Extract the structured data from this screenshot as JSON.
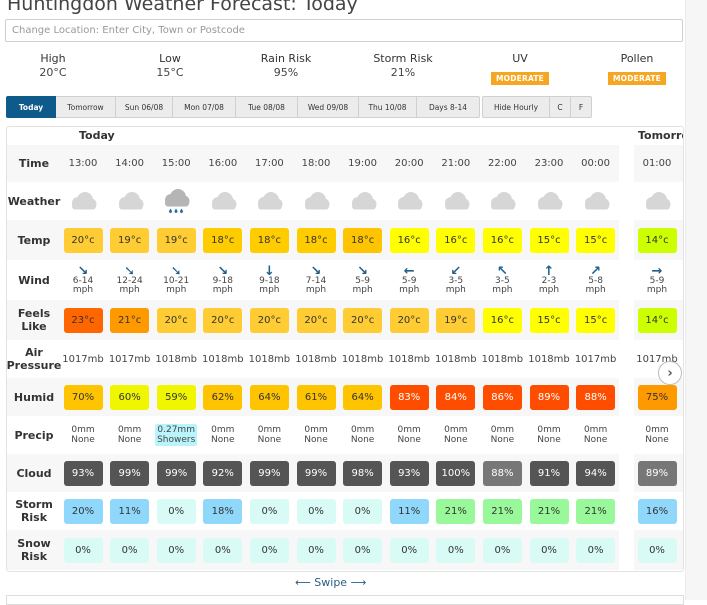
{
  "page": {
    "title": "Huntingdon Weather Forecast: Today",
    "location_placeholder": "Change Location: Enter City, Town or Postcode"
  },
  "summary": {
    "high": {
      "label": "High",
      "value": "20°C"
    },
    "low": {
      "label": "Low",
      "value": "15°C"
    },
    "rain_risk": {
      "label": "Rain Risk",
      "value": "95%"
    },
    "storm_risk": {
      "label": "Storm Risk",
      "value": "21%"
    },
    "uv": {
      "label": "UV",
      "badge": "MODERATE"
    },
    "pollen": {
      "label": "Pollen",
      "badge": "MODERATE"
    },
    "badge_color": "#f5a623"
  },
  "tabs": [
    {
      "label": "Today",
      "active": true
    },
    {
      "label": "Tomorrow",
      "active": false
    },
    {
      "label": "Sun 06/08",
      "active": false
    },
    {
      "label": "Mon 07/08",
      "active": false
    },
    {
      "label": "Tue 08/08",
      "active": false
    },
    {
      "label": "Wed 09/08",
      "active": false
    },
    {
      "label": "Thu 10/08",
      "active": false
    },
    {
      "label": "Days 8-14",
      "active": false
    }
  ],
  "options": [
    {
      "label": "Hide Hourly"
    },
    {
      "label": "C"
    },
    {
      "label": "F"
    }
  ],
  "table": {
    "day_labels": {
      "today": "Today",
      "tomorrow": "Tomorro"
    },
    "row_labels": {
      "time": "Time",
      "weather": "Weather",
      "temp": "Temp",
      "wind": "Wind",
      "feels_like": "Feels Like",
      "pressure": "Air Pressure",
      "humid": "Humid",
      "precip": "Precip",
      "cloud": "Cloud",
      "storm": "Storm Risk",
      "snow": "Snow Risk"
    },
    "hours": [
      {
        "time": "13:00",
        "weather": "cloud-icon",
        "temp": "20°c",
        "temp_color": "#ffcc33",
        "wind_dir": "↘",
        "wind": "6-14",
        "wind_unit": "mph",
        "feels": "23°c",
        "feels_color": "#ff6600",
        "pressure": "1017mb",
        "humid": "70%",
        "humid_color": "#ffc400",
        "precip_amount": "0mm",
        "precip_type": "None",
        "precip_highlight": false,
        "cloud": "93%",
        "cloud_color": "#555555",
        "storm": "20%",
        "storm_color": "#8fd8fb",
        "snow": "0%"
      },
      {
        "time": "14:00",
        "weather": "cloud-icon",
        "temp": "19°c",
        "temp_color": "#ffcc33",
        "wind_dir": "➘",
        "wind": "12-24",
        "wind_unit": "mph",
        "feels": "21°c",
        "feels_color": "#ff9900",
        "pressure": "1017mb",
        "humid": "60%",
        "humid_color": "#f0f500",
        "precip_amount": "0mm",
        "precip_type": "None",
        "precip_highlight": false,
        "cloud": "99%",
        "cloud_color": "#555555",
        "storm": "11%",
        "storm_color": "#8fd8fb",
        "snow": "0%"
      },
      {
        "time": "15:00",
        "weather": "rain-cloud-icon",
        "temp": "19°c",
        "temp_color": "#ffcc33",
        "wind_dir": "➘",
        "wind": "10-21",
        "wind_unit": "mph",
        "feels": "20°c",
        "feels_color": "#ffcc33",
        "pressure": "1018mb",
        "humid": "59%",
        "humid_color": "#f0f500",
        "precip_amount": "0.27mm",
        "precip_type": "Showers",
        "precip_highlight": true,
        "cloud": "99%",
        "cloud_color": "#555555",
        "storm": "0%",
        "storm_color": "#d9fbf6",
        "snow": "0%"
      },
      {
        "time": "16:00",
        "weather": "cloud-icon",
        "temp": "18°c",
        "temp_color": "#ffcc00",
        "wind_dir": "↘",
        "wind": "9-18",
        "wind_unit": "mph",
        "feels": "20°c",
        "feels_color": "#ffcc33",
        "pressure": "1018mb",
        "humid": "62%",
        "humid_color": "#ffc400",
        "precip_amount": "0mm",
        "precip_type": "None",
        "precip_highlight": false,
        "cloud": "92%",
        "cloud_color": "#555555",
        "storm": "18%",
        "storm_color": "#8fd8fb",
        "snow": "0%"
      },
      {
        "time": "17:00",
        "weather": "cloud-icon",
        "temp": "18°c",
        "temp_color": "#ffcc00",
        "wind_dir": "↓",
        "wind": "9-18",
        "wind_unit": "mph",
        "feels": "20°c",
        "feels_color": "#ffcc33",
        "pressure": "1018mb",
        "humid": "64%",
        "humid_color": "#ffc400",
        "precip_amount": "0mm",
        "precip_type": "None",
        "precip_highlight": false,
        "cloud": "99%",
        "cloud_color": "#555555",
        "storm": "0%",
        "storm_color": "#d9fbf6",
        "snow": "0%"
      },
      {
        "time": "18:00",
        "weather": "cloud-icon",
        "temp": "18°c",
        "temp_color": "#ffcc00",
        "wind_dir": "↘",
        "wind": "7-14",
        "wind_unit": "mph",
        "feels": "20°c",
        "feels_color": "#ffcc33",
        "pressure": "1018mb",
        "humid": "61%",
        "humid_color": "#ffc400",
        "precip_amount": "0mm",
        "precip_type": "None",
        "precip_highlight": false,
        "cloud": "99%",
        "cloud_color": "#555555",
        "storm": "0%",
        "storm_color": "#d9fbf6",
        "snow": "0%"
      },
      {
        "time": "19:00",
        "weather": "cloud-icon",
        "temp": "18°c",
        "temp_color": "#ffc400",
        "wind_dir": "↘",
        "wind": "5-9",
        "wind_unit": "mph",
        "feels": "20°c",
        "feels_color": "#ffcc33",
        "pressure": "1018mb",
        "humid": "64%",
        "humid_color": "#ffc400",
        "precip_amount": "0mm",
        "precip_type": "None",
        "precip_highlight": false,
        "cloud": "98%",
        "cloud_color": "#555555",
        "storm": "0%",
        "storm_color": "#d9fbf6",
        "snow": "0%"
      },
      {
        "time": "20:00",
        "weather": "cloud-icon",
        "temp": "16°c",
        "temp_color": "#ffff00",
        "wind_dir": "←",
        "wind": "5-9",
        "wind_unit": "mph",
        "feels": "20°c",
        "feels_color": "#ffcc33",
        "pressure": "1018mb",
        "humid": "83%",
        "humid_color": "#ff4d00",
        "precip_amount": "0mm",
        "precip_type": "None",
        "precip_highlight": false,
        "cloud": "93%",
        "cloud_color": "#555555",
        "storm": "11%",
        "storm_color": "#8fd8fb",
        "snow": "0%"
      },
      {
        "time": "21:00",
        "weather": "cloud-icon",
        "temp": "16°c",
        "temp_color": "#ffff00",
        "wind_dir": "↙",
        "wind": "3-5",
        "wind_unit": "mph",
        "feels": "19°c",
        "feels_color": "#ffcc33",
        "pressure": "1018mb",
        "humid": "84%",
        "humid_color": "#ff4d00",
        "precip_amount": "0mm",
        "precip_type": "None",
        "precip_highlight": false,
        "cloud": "100%",
        "cloud_color": "#555555",
        "storm": "21%",
        "storm_color": "#99f99a",
        "snow": "0%"
      },
      {
        "time": "22:00",
        "weather": "cloud-icon",
        "temp": "16°c",
        "temp_color": "#ffff00",
        "wind_dir": "↖",
        "wind": "3-5",
        "wind_unit": "mph",
        "feels": "16°c",
        "feels_color": "#ffff00",
        "pressure": "1018mb",
        "humid": "86%",
        "humid_color": "#ff4d00",
        "precip_amount": "0mm",
        "precip_type": "None",
        "precip_highlight": false,
        "cloud": "88%",
        "cloud_color": "#777777",
        "storm": "21%",
        "storm_color": "#99f99a",
        "snow": "0%"
      },
      {
        "time": "23:00",
        "weather": "cloud-icon",
        "temp": "15°c",
        "temp_color": "#ffff00",
        "wind_dir": "↑",
        "wind": "2-3",
        "wind_unit": "mph",
        "feels": "15°c",
        "feels_color": "#ffff00",
        "pressure": "1018mb",
        "humid": "89%",
        "humid_color": "#ff4d00",
        "precip_amount": "0mm",
        "precip_type": "None",
        "precip_highlight": false,
        "cloud": "91%",
        "cloud_color": "#555555",
        "storm": "21%",
        "storm_color": "#99f99a",
        "snow": "0%"
      },
      {
        "time": "00:00",
        "weather": "cloud-icon",
        "temp": "15°c",
        "temp_color": "#ffff00",
        "wind_dir": "↗",
        "wind": "5-8",
        "wind_unit": "mph",
        "feels": "15°c",
        "feels_color": "#ffff00",
        "pressure": "1017mb",
        "humid": "88%",
        "humid_color": "#ff4d00",
        "precip_amount": "0mm",
        "precip_type": "None",
        "precip_highlight": false,
        "cloud": "94%",
        "cloud_color": "#555555",
        "storm": "21%",
        "storm_color": "#99f99a",
        "snow": "0%"
      },
      {
        "time": "01:00",
        "weather": "cloud-icon",
        "temp": "14°c",
        "temp_color": "#ccff00",
        "wind_dir": "→",
        "wind": "5-9",
        "wind_unit": "mph",
        "feels": "14°c",
        "feels_color": "#ccff00",
        "pressure": "1017mb",
        "humid": "75%",
        "humid_color": "#ff9900",
        "precip_amount": "0mm",
        "precip_type": "None",
        "precip_highlight": false,
        "cloud": "89%",
        "cloud_color": "#777777",
        "storm": "16%",
        "storm_color": "#8fd8fb",
        "snow": "0%"
      }
    ],
    "snow_color": "#d9fbf6",
    "next_icon": "chevron-right-icon"
  },
  "swipe": {
    "label": "Swipe",
    "left_arrow": "⟵",
    "right_arrow": "⟶"
  }
}
